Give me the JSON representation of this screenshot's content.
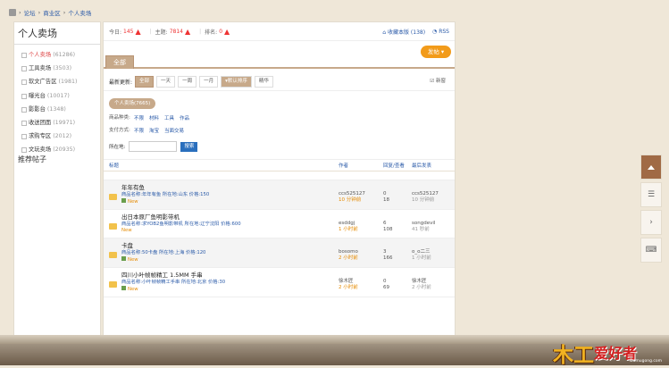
{
  "breadcrumb": [
    "论坛",
    "商业区",
    "个人卖场"
  ],
  "sidebar": {
    "title": "个人卖场",
    "items": [
      {
        "label": "个人卖场",
        "count": "(61286)"
      },
      {
        "label": "工具卖场",
        "count": "(3503)"
      },
      {
        "label": "软文广告区",
        "count": "(1981)"
      },
      {
        "label": "曝光台",
        "count": "(10017)"
      },
      {
        "label": "影影台",
        "count": "(1348)"
      },
      {
        "label": "收送团面",
        "count": "(19971)"
      },
      {
        "label": "求购专区",
        "count": "(2012)"
      },
      {
        "label": "文玩卖场",
        "count": "(20935)"
      }
    ],
    "recommend": "推荐帖子"
  },
  "stats": {
    "today_label": "今日:",
    "today": "145",
    "topics_label": "主题:",
    "topics": "7814",
    "rank_label": "排名:",
    "rank": "0",
    "fav": "收藏本版 (138)",
    "rss": "RSS"
  },
  "tab_all": "全部",
  "post_button": "发帖",
  "filter": {
    "label": "最新更新:",
    "options": [
      "全部",
      "一天",
      "一周",
      "一月"
    ],
    "sort": "默认排序",
    "digest": "精华",
    "new_window": "新窗"
  },
  "category_pill": "个人卖场(7665)",
  "filters": [
    {
      "label": "商品种类:",
      "options": [
        "不限",
        "材料",
        "工具",
        "作品"
      ]
    },
    {
      "label": "支付方式:",
      "options": [
        "不限",
        "淘宝",
        "当面交易"
      ]
    }
  ],
  "search": {
    "label": "所在地:",
    "button": "搜索"
  },
  "table_head": {
    "title": "标题",
    "author": "作者",
    "replies": "回复/查看",
    "last": "最后发表"
  },
  "threads": [
    {
      "title": "年年有鱼",
      "meta": "商品名称:年年有鱼  所在地:山东  价格:150",
      "badge": "New",
      "author": "ccs525127",
      "author_time": "10 分钟前",
      "replies": "0",
      "views": "18",
      "last_user": "ccs525127",
      "last_time": "10 分钟前"
    },
    {
      "title": "出日本原厂鱼明影带机",
      "meta": "商品名称:求YOB2鱼明影带机  所在地:辽宁沈阳  价格:600",
      "badge": "New",
      "author": "esddgj",
      "author_time": "1 小时前",
      "replies": "6",
      "views": "108",
      "last_user": "songdevil",
      "last_time": "41 秒前"
    },
    {
      "title": "卡盘",
      "meta": "商品名称:50卡盘  所在地:上海  价格:120",
      "badge": "New",
      "author": "bosomo",
      "author_time": "2 小时前",
      "replies": "3",
      "views": "166",
      "last_user": "o_o二三",
      "last_time": "1 小时前"
    },
    {
      "title": "四川小叶帧帧精工 1.5MM 手串",
      "meta": "商品名称:小叶帧帧精工手串  所在地:北京  价格:30",
      "badge": "New",
      "author": "徐木匠",
      "author_time": "2 小时前",
      "replies": "0",
      "views": "69",
      "last_user": "徐木匠",
      "last_time": "2 小时前"
    }
  ],
  "logo": {
    "mark": "木工",
    "text": "爱好者",
    "sub": "Damugong.com"
  }
}
